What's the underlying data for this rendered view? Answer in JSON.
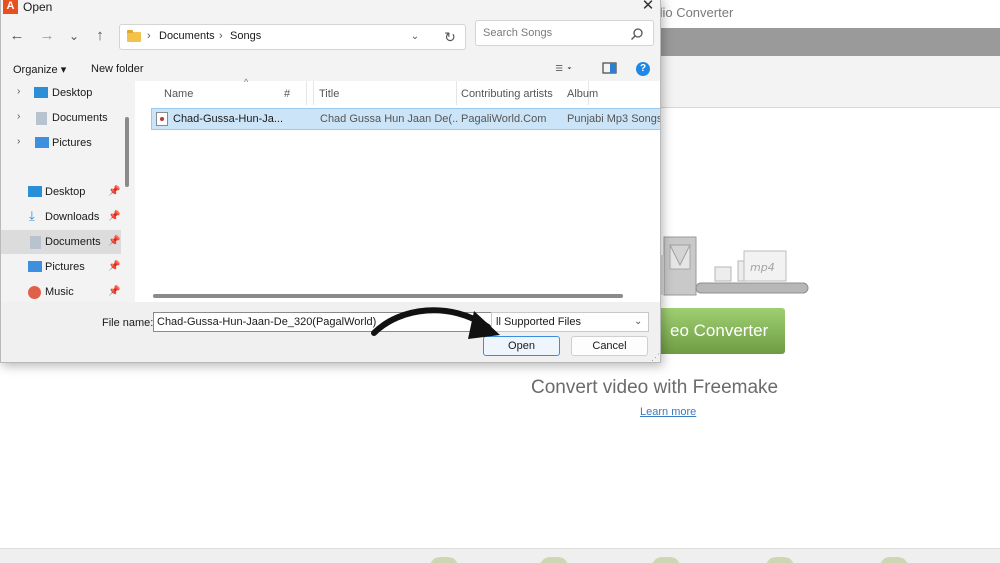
{
  "background_app": {
    "title": "udio Converter",
    "convert_button_label": "eo Converter",
    "heading": "Convert video with Freemake",
    "learn_more": "Learn more",
    "machine_label": "mp4"
  },
  "dialog": {
    "title": "Open",
    "app_icon_glyph": "A",
    "close_glyph": "✕",
    "nav": {
      "back": "←",
      "forward": "→",
      "recent": "⌄",
      "up": "↑"
    },
    "breadcrumb": [
      "Documents",
      "Songs"
    ],
    "search_placeholder": "Search Songs",
    "command_bar": {
      "organize": "Organize ▾",
      "new_folder": "New folder"
    },
    "nav_pane": {
      "tree": [
        {
          "label": "Desktop",
          "icon": "desktop-icon"
        },
        {
          "label": "Documents",
          "icon": "documents-icon"
        },
        {
          "label": "Pictures",
          "icon": "pictures-icon"
        }
      ],
      "quick_access": [
        {
          "label": "Desktop",
          "icon": "desktop-icon",
          "selected": false
        },
        {
          "label": "Downloads",
          "icon": "downloads-icon",
          "selected": false
        },
        {
          "label": "Documents",
          "icon": "documents-icon",
          "selected": true
        },
        {
          "label": "Pictures",
          "icon": "pictures-icon",
          "selected": false
        },
        {
          "label": "Music",
          "icon": "music-icon",
          "selected": false
        }
      ]
    },
    "columns": [
      "Name",
      "#",
      "Title",
      "Contributing artists",
      "Album"
    ],
    "files": [
      {
        "name": "Chad-Gussa-Hun-Ja...",
        "number": "",
        "title": "Chad Gussa Hun Jaan De(...",
        "artists": "PagaliWorld.Com",
        "album": "Punjabi Mp3 Songs -"
      }
    ],
    "file_name_label": "File name:",
    "file_name_value": "Chad-Gussa-Hun-Jaan-De_320(PagalWorld)",
    "file_type": "ll Supported Files",
    "open_button": "Open",
    "cancel_button": "Cancel"
  }
}
